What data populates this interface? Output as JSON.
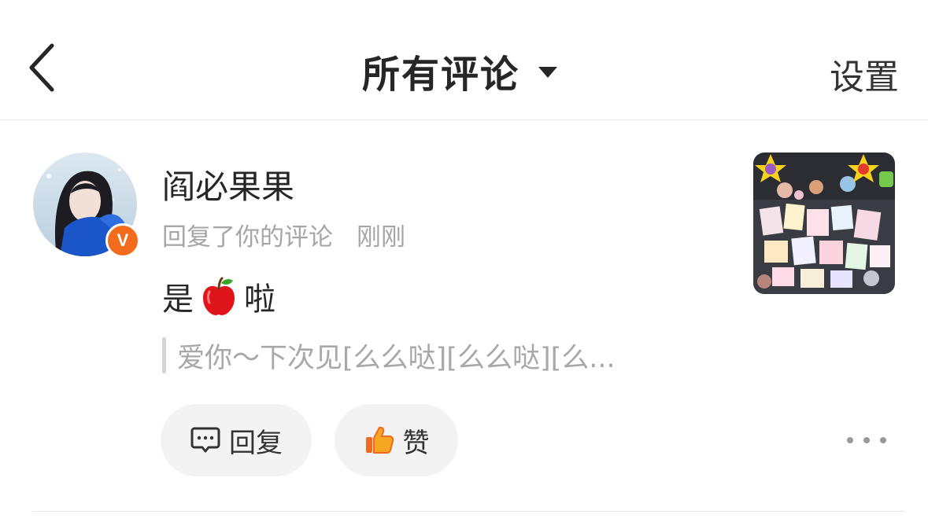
{
  "header": {
    "title": "所有评论",
    "settings_label": "设置"
  },
  "comment": {
    "username": "阎必果果",
    "action": "回复了你的评论",
    "time": "刚刚",
    "content_before": "是",
    "content_emoji": "apple",
    "content_after": "啦",
    "quoted_text": "爱你～下次见[么么哒][么么哒][么...",
    "verified_badge": "V",
    "reply_label": "回复",
    "like_label": "赞"
  },
  "icons": {
    "back": "chevron-left-icon",
    "dropdown": "caret-down-icon",
    "reply": "comment-bubble-icon",
    "like": "thumbs-up-icon",
    "more": "more-dots-icon"
  },
  "colors": {
    "accent_orange": "#f36b1c",
    "text_primary": "#262626",
    "text_secondary": "#a6a6a6",
    "pill_bg": "#f3f3f3"
  }
}
